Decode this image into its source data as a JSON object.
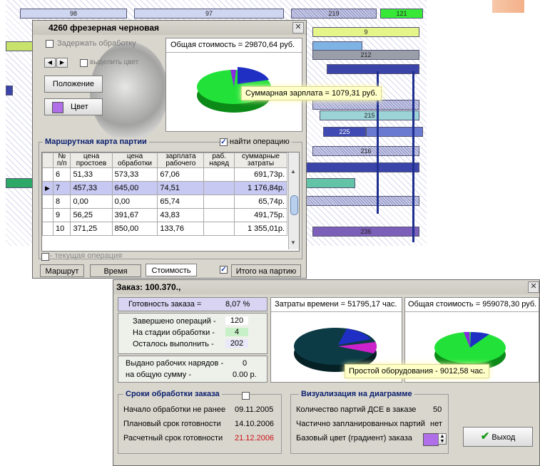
{
  "gantt": {
    "labels": [
      "98",
      "97",
      "219",
      "121",
      "212",
      "215",
      "225",
      "216",
      "236",
      "9"
    ]
  },
  "window1": {
    "title": "4260 фрезерная черновая",
    "hold_label": "Задержать обработку",
    "highlight_label": "выделить цвет",
    "position_button": "Положение",
    "color_button": "Цвет",
    "total_cost": "Общая стоимость = 29870,64 руб.",
    "salary_callout": "Суммарная зарплата = 1079,31 руб.",
    "route_title": "Маршрутная карта партии",
    "find_operation": "найти операцию",
    "columns": [
      "№ п/п",
      "цена простоев",
      "цена обработки",
      "зарплата рабочего",
      "раб. наряд",
      "суммарные затраты"
    ],
    "rows": [
      {
        "n": "6",
        "idle": "51,33",
        "proc": "573,33",
        "salary": "67,06",
        "work": "",
        "total": "691,73р."
      },
      {
        "n": "7",
        "idle": "457,33",
        "proc": "645,00",
        "salary": "74,51",
        "work": "",
        "total": "1 176,84р."
      },
      {
        "n": "8",
        "idle": "0,00",
        "proc": "0,00",
        "salary": "65,74",
        "work": "",
        "total": "65,74р."
      },
      {
        "n": "9",
        "idle": "56,25",
        "proc": "391,67",
        "salary": "43,83",
        "work": "",
        "total": "491,75р."
      },
      {
        "n": "10",
        "idle": "371,25",
        "proc": "850,00",
        "salary": "133,76",
        "work": "",
        "total": "1 355,01р."
      }
    ],
    "current_operation": "- текущая операция",
    "tabs": [
      "Маршрут",
      "Время",
      "Стоимость"
    ],
    "batch_total": "Итого на партию"
  },
  "window2": {
    "title": "Заказ: 100.370.,",
    "readiness_label": "Готовность заказа =",
    "readiness_value": "8,07 %",
    "time_cost": "Затраты времени = 51795,17 час.",
    "total_cost": "Общая стоимость = 959078,30 руб.",
    "ops": [
      {
        "label": "Завершено операций -",
        "value": "120"
      },
      {
        "label": "На стадии обработки -",
        "value": "4"
      },
      {
        "label": "Осталось выполнить -",
        "value": "202"
      }
    ],
    "issued_label": "Выдано рабочих нарядов -",
    "issued_value": "0",
    "sum_label": "на общую сумму -",
    "sum_value": "0.00 р.",
    "idle_callout": "Простой оборудования - 9012,58 час.",
    "terms_title": "Сроки обработки заказа",
    "terms": [
      {
        "label": "Начало обработки не ранее",
        "value": "09.11.2005"
      },
      {
        "label": "Плановый срок готовности",
        "value": "14.10.2006"
      },
      {
        "label": "Расчетный срок готовности",
        "value": "21.12.2006"
      }
    ],
    "viz_title": "Визуализация на диаграмме",
    "viz": [
      {
        "label": "Количество партий ДСЕ  в заказе",
        "value": "50"
      },
      {
        "label": "Частично запланированных партий",
        "value": "нет"
      }
    ],
    "base_color_label": "Базовый цвет (градиент)  заказа",
    "exit_button": "Выход"
  },
  "colors": {
    "accent_red": "#cc1111",
    "pie_green": "#22e23a",
    "pie_blue": "#1f2fc4",
    "pie_violet": "#8a2be2",
    "pie_dark": "#0c3b45",
    "base_color": "#b06ee8"
  }
}
